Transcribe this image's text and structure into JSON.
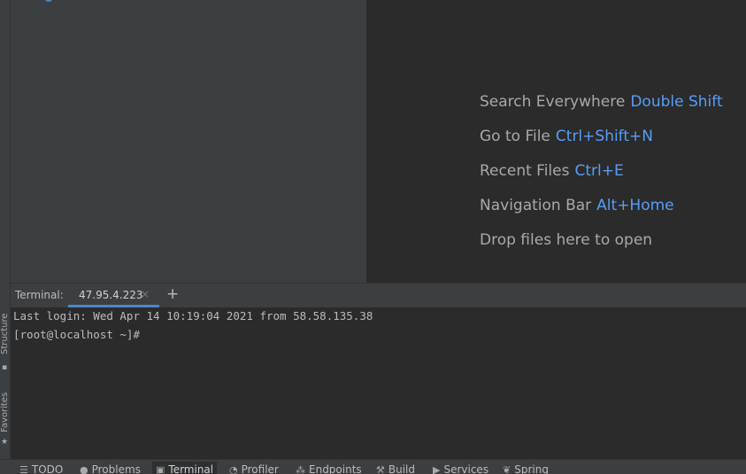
{
  "editor_hints": [
    {
      "label": "Search Everywhere",
      "shortcut": "Double Shift"
    },
    {
      "label": "Go to File",
      "shortcut": "Ctrl+Shift+N"
    },
    {
      "label": "Recent Files",
      "shortcut": "Ctrl+E"
    },
    {
      "label": "Navigation Bar",
      "shortcut": "Alt+Home"
    },
    {
      "label": "Drop files here to open",
      "shortcut": ""
    }
  ],
  "terminal": {
    "title": "Terminal:",
    "tab_label": "47.95.4.223",
    "close_glyph": "×",
    "add_glyph": "+",
    "lines": [
      "Last login: Wed Apr 14 10:19:04 2021 from 58.58.135.38",
      "[root@localhost ~]#"
    ]
  },
  "left_stripe": {
    "structure_label": "Structure",
    "favorites_label": "Favorites"
  },
  "bottom_bar": {
    "items": [
      {
        "label": "TODO",
        "icon": "list-icon"
      },
      {
        "label": "Problems",
        "icon": "problems-icon"
      },
      {
        "label": "Terminal",
        "icon": "terminal-icon"
      },
      {
        "label": "Profiler",
        "icon": "profiler-icon"
      },
      {
        "label": "Endpoints",
        "icon": "endpoints-icon"
      },
      {
        "label": "Build",
        "icon": "hammer-icon"
      },
      {
        "label": "Services",
        "icon": "services-icon"
      },
      {
        "label": "Spring",
        "icon": "spring-icon"
      }
    ]
  },
  "colors": {
    "accent": "#4a88c7",
    "shortcut": "#589df6",
    "panel": "#3c3f41",
    "editor": "#2b2b2b"
  }
}
